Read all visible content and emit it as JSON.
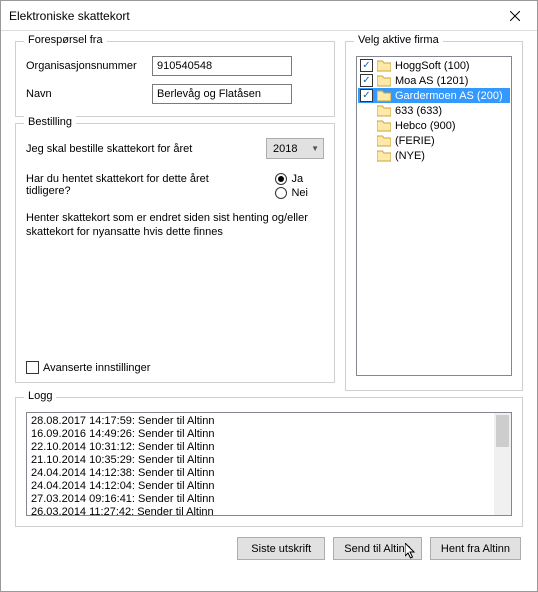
{
  "window": {
    "title": "Elektroniske skattekort"
  },
  "forespor": {
    "legend": "Forespørsel fra",
    "orgnr_label": "Organisasjonsnummer",
    "orgnr_value": "910540548",
    "navn_label": "Navn",
    "navn_value": "Berlevåg og Flatåsen"
  },
  "bestilling": {
    "legend": "Bestilling",
    "line1": "Jeg skal bestille skattekort for året",
    "year": "2018",
    "q": "Har du hentet skattekort for dette året tidligere?",
    "opt_yes": "Ja",
    "opt_no": "Nei",
    "selected": "Ja",
    "info": "Henter skattekort som er endret siden sist henting og/eller skattekort for nyansatte hvis dette finnes",
    "adv_label": "Avanserte innstillinger",
    "adv_checked": false
  },
  "firma": {
    "legend": "Velg aktive firma",
    "items": [
      {
        "label": "HoggSoft (100)",
        "checked": true,
        "hascb": true,
        "selected": false
      },
      {
        "label": "Moa AS (1201)",
        "checked": true,
        "hascb": true,
        "selected": false
      },
      {
        "label": "Gardermoen AS (200)",
        "checked": true,
        "hascb": true,
        "selected": true
      },
      {
        "label": "633 (633)",
        "checked": false,
        "hascb": false,
        "selected": false
      },
      {
        "label": "Hebco (900)",
        "checked": false,
        "hascb": false,
        "selected": false
      },
      {
        "label": "(FERIE)",
        "checked": false,
        "hascb": false,
        "selected": false
      },
      {
        "label": "(NYE)",
        "checked": false,
        "hascb": false,
        "selected": false
      }
    ]
  },
  "logg": {
    "legend": "Logg",
    "lines": [
      "28.08.2017 14:17:59: Sender til Altinn",
      "16.09.2016 14:49:26: Sender til Altinn",
      "22.10.2014 10:31:12: Sender til Altinn",
      "21.10.2014 10:35:29: Sender til Altinn",
      "24.04.2014 14:12:38: Sender til Altinn",
      "24.04.2014 14:12:04: Sender til Altinn",
      "27.03.2014 09:16:41: Sender til Altinn",
      "26.03.2014 11:27:42: Sender til Altinn"
    ]
  },
  "buttons": {
    "siste": "Siste utskrift",
    "send": "Send til Altinn",
    "hent": "Hent fra Altinn"
  }
}
